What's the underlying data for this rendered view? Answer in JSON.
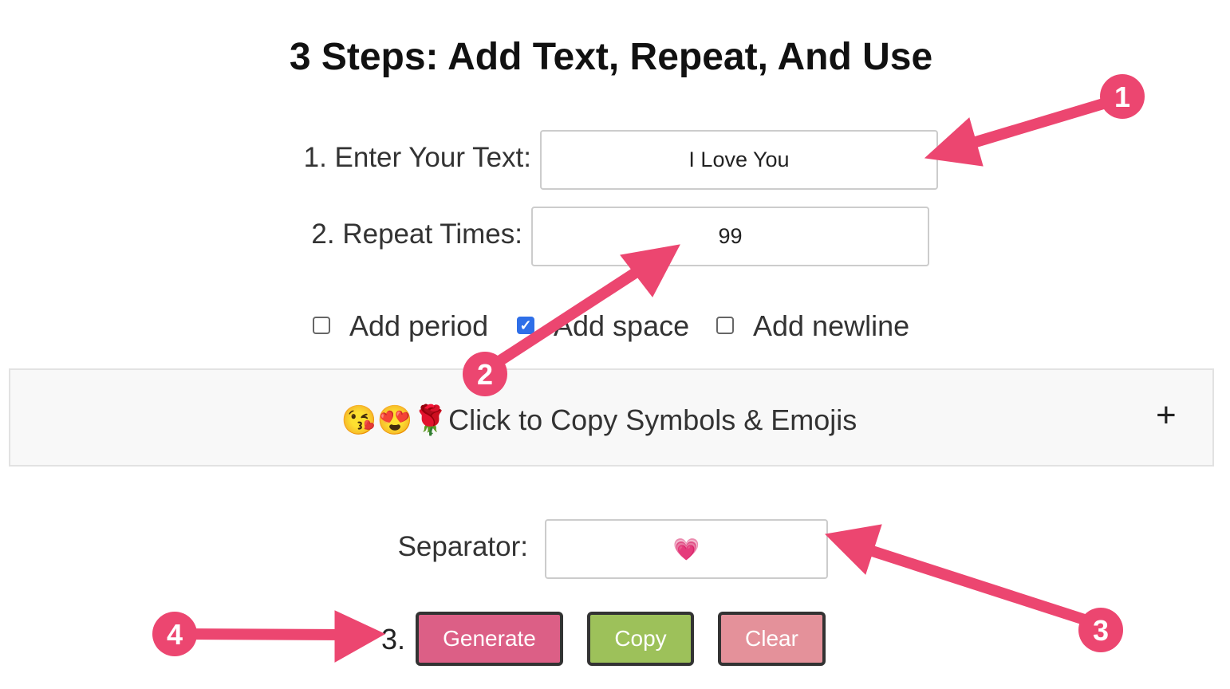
{
  "title": "3 Steps: Add Text, Repeat, And Use",
  "text_field": {
    "label": "1. Enter Your Text:",
    "value": "I Love You"
  },
  "repeat_field": {
    "label": "2. Repeat Times:",
    "value": "99"
  },
  "options": [
    {
      "label": "Add period",
      "checked": false
    },
    {
      "label": "Add space",
      "checked": true
    },
    {
      "label": "Add newline",
      "checked": false
    }
  ],
  "accordion": {
    "label": "😘😍🌹Click to Copy Symbols & Emojis",
    "toggle": "+"
  },
  "separator": {
    "label": "Separator:",
    "value": "💗"
  },
  "step3": "3.",
  "buttons": {
    "generate": "Generate",
    "copy": "Copy",
    "clear": "Clear"
  },
  "button_colors": {
    "generate": "#dc5f86",
    "copy": "#9dc15a",
    "clear": "#e4919a"
  },
  "annotations": [
    "1",
    "2",
    "3",
    "4"
  ],
  "annotation_color": "#ec4670"
}
